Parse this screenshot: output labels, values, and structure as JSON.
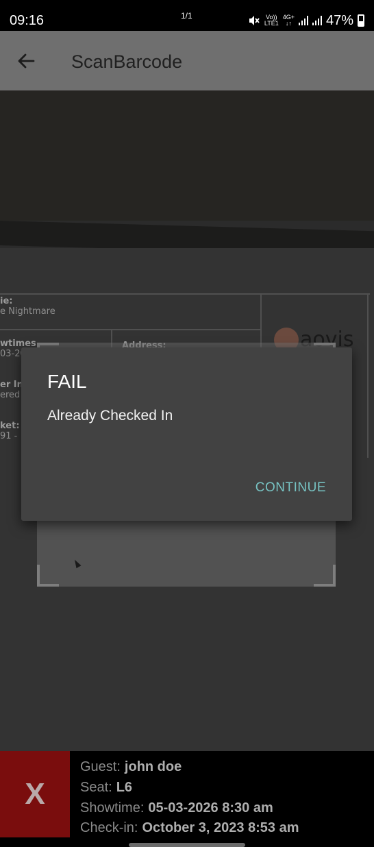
{
  "status_bar": {
    "time": "09:16",
    "page_indicator": "1/1",
    "mute_icon": "mute-icon",
    "volte_top": "Vo))",
    "volte_bottom": "LTE1",
    "network_type": "4G+",
    "battery_percent": "47%"
  },
  "app_bar": {
    "title": "ScanBarcode",
    "back_icon": "arrow-left-icon"
  },
  "camera_view": {
    "ticket_fields": [
      {
        "label": "ie:",
        "value": "e Nightmare"
      },
      {
        "label": "wtimes",
        "value": "03-20"
      },
      {
        "label": "Address:",
        "value": ""
      },
      {
        "label": "er In",
        "value": "ered"
      },
      {
        "label": "ket:",
        "value": "91 -"
      }
    ],
    "logo_text": "aovis"
  },
  "dialog": {
    "title": "FAIL",
    "message": "Already Checked In",
    "button_label": "CONTINUE",
    "button_color": "#77c3c3"
  },
  "result": {
    "status_symbol": "X",
    "status_color": "#7a0d0d",
    "guest_label": "Guest:",
    "guest_value": "john doe",
    "seat_label": "Seat:",
    "seat_value": "L6",
    "showtime_label": "Showtime:",
    "showtime_value": "05-03-2026 8:30 am",
    "checkin_label": "Check-in:",
    "checkin_value": "October 3, 2023 8:53 am"
  }
}
